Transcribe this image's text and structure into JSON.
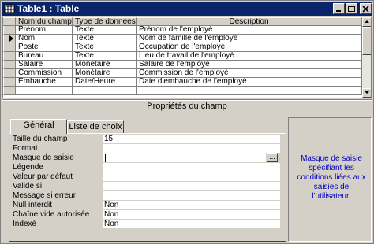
{
  "window": {
    "title": "Table1 : Table",
    "icon": "table-icon"
  },
  "grid": {
    "columns": [
      "Nom du champ",
      "Type de données",
      "Description"
    ],
    "rows": [
      {
        "name": "Prénom",
        "type": "Texte",
        "description": "Prénom de l'employé",
        "selected": false
      },
      {
        "name": "Nom",
        "type": "Texte",
        "description": "Nom de famille de l'employé",
        "selected": true
      },
      {
        "name": "Poste",
        "type": "Texte",
        "description": "Occupation de l'employé",
        "selected": false
      },
      {
        "name": "Bureau",
        "type": "Texte",
        "description": "Lieu de travail de l'employé",
        "selected": false
      },
      {
        "name": "Salaire",
        "type": "Monétaire",
        "description": "Salaire de l'employé",
        "selected": false
      },
      {
        "name": "Commission",
        "type": "Monétaire",
        "description": "Commission de l'employé",
        "selected": false
      },
      {
        "name": "Embauche",
        "type": "Date/Heure",
        "description": "Date d'embauche de l'employé",
        "selected": false
      }
    ]
  },
  "properties": {
    "title": "Propriétés du champ",
    "tabs": [
      {
        "label": "Général",
        "active": true
      },
      {
        "label": "Liste de choix",
        "active": false
      }
    ],
    "fields": [
      {
        "label": "Taille du champ",
        "value": "15"
      },
      {
        "label": "Format",
        "value": ""
      },
      {
        "label": "Masque de saisie",
        "value": "",
        "has_builder": true
      },
      {
        "label": "Légende",
        "value": ""
      },
      {
        "label": "Valeur par défaut",
        "value": ""
      },
      {
        "label": "Valide si",
        "value": ""
      },
      {
        "label": "Message si erreur",
        "value": ""
      },
      {
        "label": "Null interdit",
        "value": "Non"
      },
      {
        "label": "Chaîne vide autorisée",
        "value": "Non"
      },
      {
        "label": "Indexé",
        "value": "Non"
      }
    ],
    "builder_button": "...",
    "help": "Masque de saisie spécifiant les conditions liées aux saisies de l'utilisateur."
  },
  "colors": {
    "title_bar": "#0a246a",
    "face": "#d4d0c8",
    "help_text": "#0000c0"
  }
}
